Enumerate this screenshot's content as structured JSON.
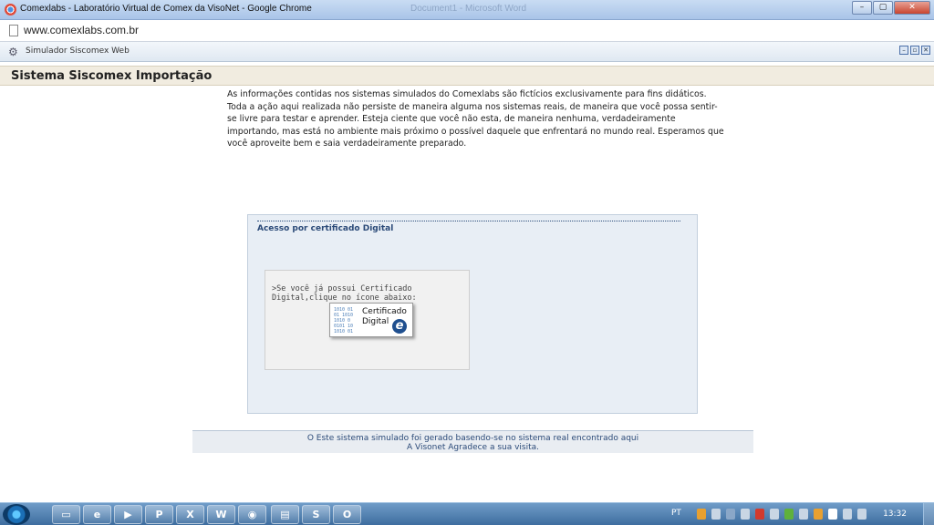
{
  "window": {
    "title": "Comexlabs - Laboratório Virtual de Comex da VisoNet - Google Chrome",
    "background_title": "Document1 - Microsoft Word"
  },
  "address_bar": {
    "url": "www.comexlabs.com.br"
  },
  "app_header": {
    "label": "Simulador Siscomex Web"
  },
  "page": {
    "title": "Sistema Siscomex Importação",
    "intro_line1": "As informações contidas nos sistemas simulados do Comexlabs são fictícios exclusivamente para fins didáticos.",
    "intro_line2": "Toda a ação aqui realizada não persiste de maneira alguma nos sistemas reais, de maneira que você possa sentir-se livre para testar e aprender. Esteja ciente que você não esta, de maneira nenhuma, verdadeiramente importando, mas está no ambiente mais próximo o possível daquele que enfrentará no mundo real. Esperamos que você aproveite bem e saia verdadeiramente preparado."
  },
  "access_panel": {
    "title": "Acesso por certificado Digital",
    "instruction": ">Se você já possui Certificado Digital,clique no ícone abaixo:",
    "button_line1": "Certificado",
    "button_line2": "Digital",
    "button_mark": "e",
    "button_bits": "1010 01\n01 1010\n1010 0\n0101 10\n1010 01"
  },
  "footer": {
    "line1_prefix": "O Este sistema simulado foi gerado basendo-se no sistema real encontrado ",
    "line1_link": "aqui",
    "line2": "A Visonet Agradece a sua visita."
  },
  "taskbar": {
    "apps": [
      "folder",
      "ie",
      "media",
      "P",
      "X",
      "W",
      "chrome",
      "explorer",
      "S",
      "O"
    ],
    "lang": "PT",
    "clock": "13:32"
  }
}
